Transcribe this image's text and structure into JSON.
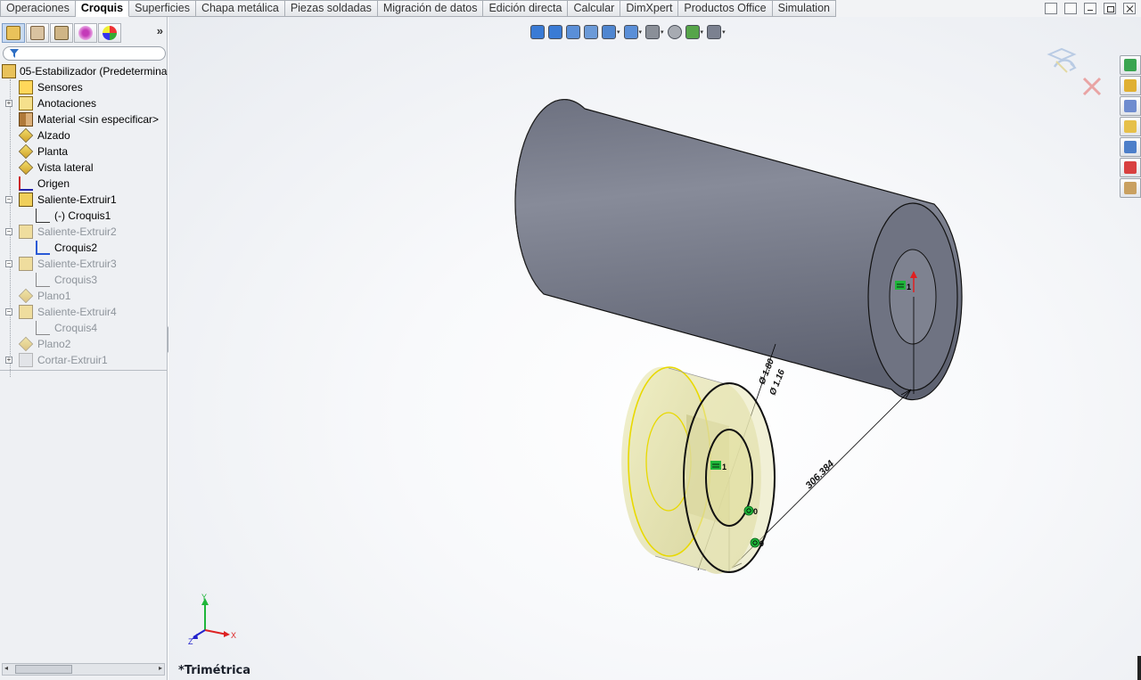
{
  "tabs": [
    {
      "label": "Operaciones",
      "active": false
    },
    {
      "label": "Croquis",
      "active": true
    },
    {
      "label": "Superficies",
      "active": false
    },
    {
      "label": "Chapa metálica",
      "active": false
    },
    {
      "label": "Piezas soldadas",
      "active": false
    },
    {
      "label": "Migración de datos",
      "active": false
    },
    {
      "label": "Edición directa",
      "active": false
    },
    {
      "label": "Calcular",
      "active": false
    },
    {
      "label": "DimXpert",
      "active": false
    },
    {
      "label": "Productos Office",
      "active": false
    },
    {
      "label": "Simulation",
      "active": false
    }
  ],
  "panel": {
    "tab_icons": [
      "featuremanager-icon",
      "propertymanager-icon",
      "configurationmanager-icon",
      "dimxpertmanager-icon",
      "displaymanager-icon"
    ],
    "more_label": "»"
  },
  "tree": [
    {
      "label": "05-Estabilizador  (Predetermina",
      "icon": "part-icon",
      "expand": "",
      "dim": false
    },
    {
      "label": "Sensores",
      "icon": "sensors-icon",
      "expand": "",
      "dim": false
    },
    {
      "label": "Anotaciones",
      "icon": "annotations-icon",
      "expand": "+",
      "dim": false
    },
    {
      "label": "Material <sin especificar>",
      "icon": "material-icon",
      "expand": "",
      "dim": false
    },
    {
      "label": "Alzado",
      "icon": "plane-icon",
      "expand": "",
      "dim": false
    },
    {
      "label": "Planta",
      "icon": "plane-icon",
      "expand": "",
      "dim": false
    },
    {
      "label": "Vista lateral",
      "icon": "plane-icon",
      "expand": "",
      "dim": false
    },
    {
      "label": "Origen",
      "icon": "origin-icon",
      "expand": "",
      "dim": false
    },
    {
      "label": "Saliente-Extruir1",
      "icon": "extrude-icon",
      "expand": "−",
      "dim": false
    },
    {
      "label": "(-) Croquis1",
      "icon": "sketch-icon",
      "expand": "",
      "dim": false
    },
    {
      "label": "Saliente-Extruir2",
      "icon": "extrude-icon",
      "expand": "−",
      "dim": true
    },
    {
      "label": "Croquis2",
      "icon": "sketch-active-icon",
      "expand": "",
      "dim": false
    },
    {
      "label": "Saliente-Extruir3",
      "icon": "extrude-icon",
      "expand": "−",
      "dim": true
    },
    {
      "label": "Croquis3",
      "icon": "sketch-icon",
      "expand": "",
      "dim": true
    },
    {
      "label": "Plano1",
      "icon": "plane-icon",
      "expand": "",
      "dim": true
    },
    {
      "label": "Saliente-Extruir4",
      "icon": "extrude-icon",
      "expand": "−",
      "dim": true
    },
    {
      "label": "Croquis4",
      "icon": "sketch-icon",
      "expand": "",
      "dim": true
    },
    {
      "label": "Plano2",
      "icon": "plane-icon",
      "expand": "",
      "dim": true
    },
    {
      "label": "Cortar-Extruir1",
      "icon": "cut-extrude-icon",
      "expand": "+",
      "dim": true
    }
  ],
  "headsup_icons": [
    "zoom-to-fit-icon",
    "zoom-to-area-icon",
    "previous-view-icon",
    "section-view-icon",
    "view-orientation-icon",
    "display-style-icon",
    "hide-show-items-icon",
    "edit-appearance-icon",
    "apply-scene-icon",
    "view-settings-icon"
  ],
  "viewport": {
    "view_name": "*Trimétrica",
    "dimensions": [
      "306.384",
      "Ø 1.80",
      "Ø 1.16"
    ],
    "relation_tags": [
      "1",
      "1",
      "0",
      "0"
    ],
    "triad": {
      "x": "X",
      "y": "Y",
      "z": "Z"
    }
  },
  "taskpane_icons": [
    "solidworks-resources-icon",
    "home-icon",
    "design-library-icon",
    "file-explorer-icon",
    "view-palette-icon",
    "appearances-icon",
    "custom-properties-icon"
  ],
  "colors": {
    "tab_active": "#ffffff",
    "model_body": "#7b7f8d",
    "model_end": "#6c707f",
    "sketch_highlight": "#e8d900",
    "relation_green": "#1fb63a"
  }
}
